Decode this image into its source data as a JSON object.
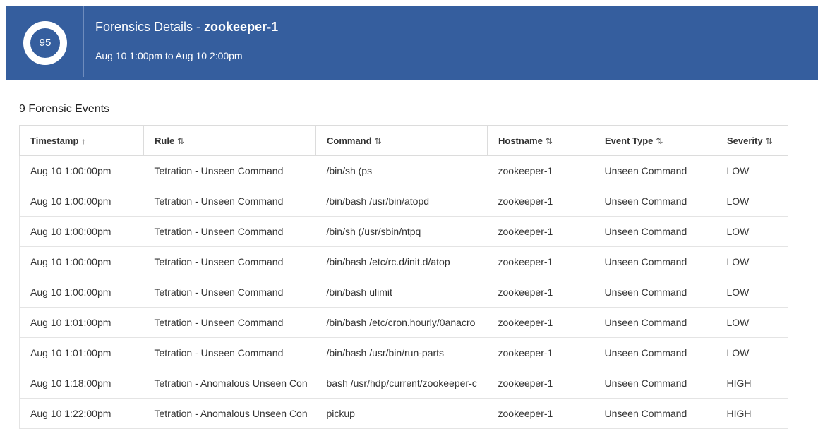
{
  "header": {
    "score": "95",
    "title_prefix": "Forensics Details - ",
    "title_host": "zookeeper-1",
    "subtitle": "Aug 10 1:00pm to Aug 10 2:00pm",
    "bg_color": "#355e9e"
  },
  "events_count_label": "9 Forensic Events",
  "table": {
    "columns": [
      {
        "label": "Timestamp",
        "sort_icon": "↑"
      },
      {
        "label": "Rule",
        "sort_icon": "⇅"
      },
      {
        "label": "Command",
        "sort_icon": "⇅"
      },
      {
        "label": "Hostname",
        "sort_icon": "⇅"
      },
      {
        "label": "Event Type",
        "sort_icon": "⇅"
      },
      {
        "label": "Severity",
        "sort_icon": "⇅"
      }
    ],
    "rows": [
      [
        "Aug 10 1:00:00pm",
        "Tetration - Unseen Command",
        "/bin/sh (ps",
        "zookeeper-1",
        "Unseen Command",
        "LOW"
      ],
      [
        "Aug 10 1:00:00pm",
        "Tetration - Unseen Command",
        "/bin/bash /usr/bin/atopd",
        "zookeeper-1",
        "Unseen Command",
        "LOW"
      ],
      [
        "Aug 10 1:00:00pm",
        "Tetration - Unseen Command",
        "/bin/sh (/usr/sbin/ntpq",
        "zookeeper-1",
        "Unseen Command",
        "LOW"
      ],
      [
        "Aug 10 1:00:00pm",
        "Tetration - Unseen Command",
        "/bin/bash /etc/rc.d/init.d/atop",
        "zookeeper-1",
        "Unseen Command",
        "LOW"
      ],
      [
        "Aug 10 1:00:00pm",
        "Tetration - Unseen Command",
        "/bin/bash ulimit",
        "zookeeper-1",
        "Unseen Command",
        "LOW"
      ],
      [
        "Aug 10 1:01:00pm",
        "Tetration - Unseen Command",
        "/bin/bash /etc/cron.hourly/0anacro",
        "zookeeper-1",
        "Unseen Command",
        "LOW"
      ],
      [
        "Aug 10 1:01:00pm",
        "Tetration - Unseen Command",
        "/bin/bash /usr/bin/run-parts",
        "zookeeper-1",
        "Unseen Command",
        "LOW"
      ],
      [
        "Aug 10 1:18:00pm",
        "Tetration - Anomalous Unseen Con",
        "bash /usr/hdp/current/zookeeper-c",
        "zookeeper-1",
        "Unseen Command",
        "HIGH"
      ],
      [
        "Aug 10 1:22:00pm",
        "Tetration - Anomalous Unseen Con",
        "pickup",
        "zookeeper-1",
        "Unseen Command",
        "HIGH"
      ]
    ]
  }
}
